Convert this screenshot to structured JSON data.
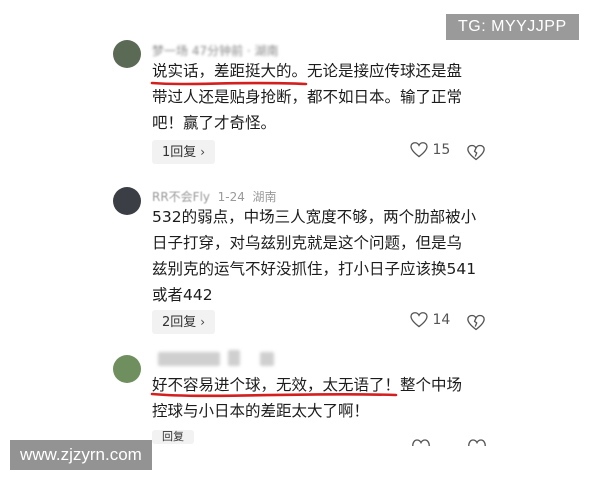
{
  "watermark_top": "TG: MYYJJPP",
  "watermark_bottom": "www.zjzyrn.com",
  "comments": [
    {
      "user": "梦一场",
      "meta": "47分钟前 · 湖南",
      "lines": [
        "说实话，差距挺大的。无论是接应传球还是盘",
        "带过人还是贴身抢断，都不如日本。输了正常",
        "吧！赢了才奇怪。"
      ],
      "replies": "1回复",
      "likes": "15"
    },
    {
      "user": "RR不会Fly",
      "date": "1-24",
      "location": "湖南",
      "lines": [
        "532的弱点，中场三人宽度不够，两个肋部被小",
        "日子打穿，对乌兹别克就是这个问题，但是乌",
        "兹别克的运气不好没抓住，打小日子应该换541",
        "或者442"
      ],
      "replies": "2回复",
      "likes": "14"
    },
    {
      "lines": [
        "好不容易进个球，无效，太无语了！整个中场",
        "控球与小日本的差距太大了啊！"
      ],
      "replies": "回复"
    }
  ],
  "colors": {
    "underline": "#d41f1f",
    "pill_bg": "#f2f2f2"
  }
}
